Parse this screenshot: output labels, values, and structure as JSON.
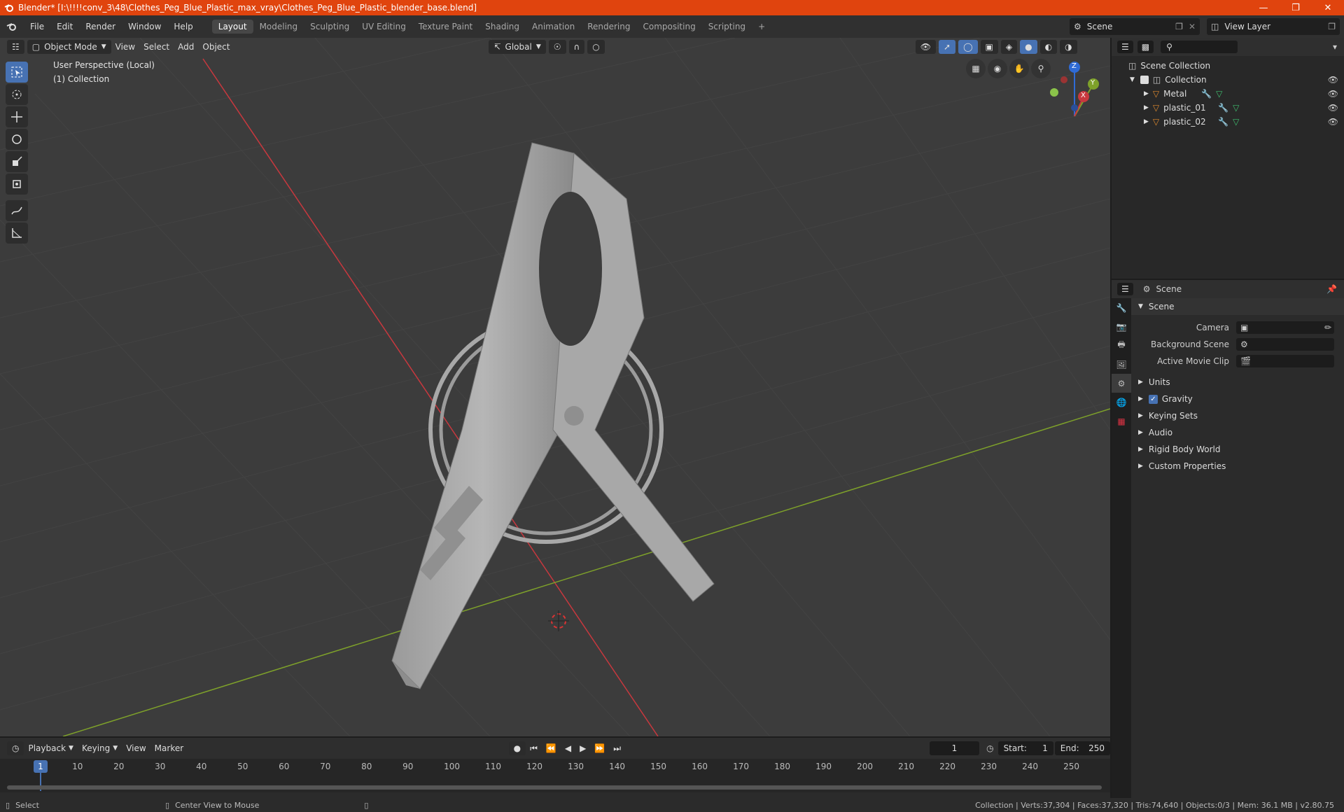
{
  "window": {
    "title": "Blender* [I:\\!!!!conv_3\\48\\Clothes_Peg_Blue_Plastic_max_vray\\Clothes_Peg_Blue_Plastic_blender_base.blend]"
  },
  "menu": {
    "items": [
      "File",
      "Edit",
      "Render",
      "Window",
      "Help"
    ]
  },
  "workspaces": {
    "tabs": [
      "Layout",
      "Modeling",
      "Sculpting",
      "UV Editing",
      "Texture Paint",
      "Shading",
      "Animation",
      "Rendering",
      "Compositing",
      "Scripting"
    ],
    "active": "Layout",
    "add": "+"
  },
  "scene_selector": {
    "value": "Scene"
  },
  "viewlayer_selector": {
    "value": "View Layer"
  },
  "viewport": {
    "mode": "Object Mode",
    "menus": [
      "View",
      "Select",
      "Add",
      "Object"
    ],
    "transform_orientation": "Global",
    "overlay_line1": "User Perspective (Local)",
    "overlay_line2": "(1) Collection",
    "gizmo": {
      "z": "Z",
      "y": "Y",
      "x": "X"
    }
  },
  "outliner": {
    "root": "Scene Collection",
    "collection": "Collection",
    "objects": [
      "Metal",
      "plastic_01",
      "plastic_02"
    ]
  },
  "properties": {
    "context": "Scene",
    "section_title": "Scene",
    "camera_label": "Camera",
    "background_scene_label": "Background Scene",
    "active_movie_clip_label": "Active Movie Clip",
    "sections": [
      "Units",
      "Gravity",
      "Keying Sets",
      "Audio",
      "Rigid Body World",
      "Custom Properties"
    ],
    "gravity_checked": true
  },
  "timeline": {
    "menus": [
      "Playback",
      "Keying",
      "View",
      "Marker"
    ],
    "current_frame": "1",
    "start_label": "Start:",
    "start": "1",
    "end_label": "End:",
    "end": "250",
    "ticks": [
      "1",
      "10",
      "20",
      "30",
      "40",
      "50",
      "60",
      "70",
      "80",
      "90",
      "100",
      "110",
      "120",
      "130",
      "140",
      "150",
      "160",
      "170",
      "180",
      "190",
      "200",
      "210",
      "220",
      "230",
      "240",
      "250"
    ]
  },
  "status": {
    "left": "Select",
    "middle": "Center View to Mouse",
    "right": "Collection | Verts:37,304 | Faces:37,320 | Tris:74,640 | Objects:0/3 | Mem: 36.1 MB | v2.80.75"
  },
  "colors": {
    "titlebar": "#e0440e",
    "accent": "#4772b3",
    "x_axis": "#c8383e",
    "y_axis": "#7ea12a",
    "z_axis": "#2f6bd6"
  }
}
